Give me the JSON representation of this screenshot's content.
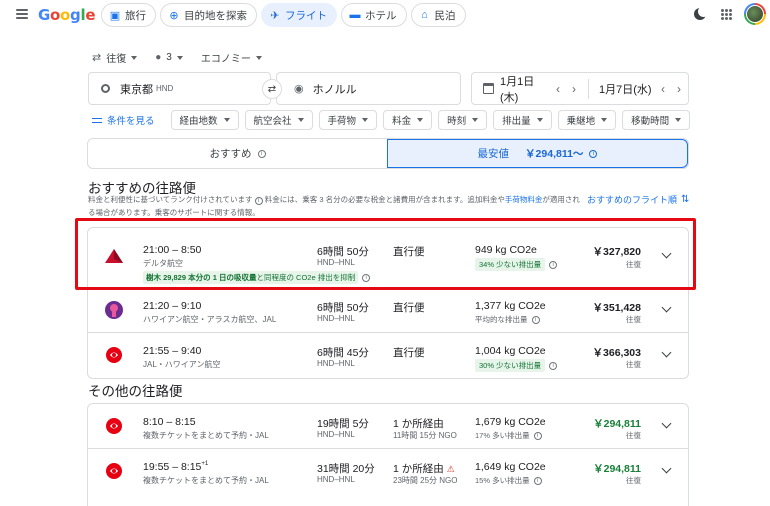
{
  "logo": {
    "g1": "G",
    "o1": "o",
    "o2": "o",
    "g2": "g",
    "l": "l",
    "e": "e"
  },
  "nav": [
    {
      "icon": "suitcase-icon",
      "glyph": "▣",
      "label": "旅行"
    },
    {
      "icon": "explore-icon",
      "glyph": "⊕",
      "label": "目的地を探索"
    },
    {
      "icon": "plane-icon",
      "glyph": "✈",
      "label": "フライト"
    },
    {
      "icon": "hotel-icon",
      "glyph": "▬",
      "label": "ホテル"
    },
    {
      "icon": "house-icon",
      "glyph": "⌂",
      "label": "民泊"
    }
  ],
  "trip": {
    "type": "往復",
    "passengers": "3",
    "cabin": "エコノミー"
  },
  "search": {
    "from": "東京都",
    "from_code": "HND",
    "to": "ホノルル",
    "depart": "1月1日(木)",
    "return": "1月7日(水)"
  },
  "filters": {
    "all": "条件を見る",
    "chips": [
      "経由地数",
      "航空会社",
      "手荷物",
      "料金",
      "時刻",
      "排出量",
      "乗継地",
      "移動時間"
    ]
  },
  "sort": {
    "best": "おすすめ",
    "cheapest": "最安値",
    "cheapest_price": "￥294,811～"
  },
  "best_section": {
    "title": "おすすめの往路便",
    "disclaimer_1": "料金と利便性に基づいてランク付けされています",
    "disclaimer_2": "料金には、乗客 3 名分の必要な税金と諸費用が含まれます。追加料金や",
    "disclaimer_link": "手荷物料金",
    "disclaimer_3": "が適用され",
    "disclaimer_4": "る場合があります。乗客のサポートに関する情報。",
    "sort_link": "おすすめのフライト順"
  },
  "best_flights": [
    {
      "logo": "delta",
      "times": "21:00 – 8:50",
      "sup": "",
      "airline": "デルタ航空",
      "duration": "6時間 50分",
      "route": "HND–HNL",
      "stops": "直行便",
      "stops_sub": "",
      "co2": "949 kg CO2e",
      "co2_badge": "34% 少ない排出量",
      "co2_plain": "",
      "price": "￥327,820",
      "price_sub": "往復",
      "eco_bold": "樹木 29,829 本分の 1 日の吸収量",
      "eco_rest": "と同程度の CO2e 排出を抑制"
    },
    {
      "logo": "hawaiian",
      "times": "21:20 – 9:10",
      "sup": "",
      "airline": "ハワイアン航空・アラスカ航空、JAL",
      "duration": "6時間 50分",
      "route": "HND–HNL",
      "stops": "直行便",
      "stops_sub": "",
      "co2": "1,377 kg CO2e",
      "co2_badge": "",
      "co2_plain": "平均的な排出量",
      "price": "￥351,428",
      "price_sub": "往復"
    },
    {
      "logo": "jal",
      "times": "21:55 – 9:40",
      "sup": "",
      "airline": "JAL・ハワイアン航空",
      "duration": "6時間 45分",
      "route": "HND–HNL",
      "stops": "直行便",
      "stops_sub": "",
      "co2": "1,004 kg CO2e",
      "co2_badge": "30% 少ない排出量",
      "co2_plain": "",
      "price": "￥366,303",
      "price_sub": "往復"
    }
  ],
  "other_section": {
    "title": "その他の往路便"
  },
  "other_flights": [
    {
      "logo": "jal",
      "times": "8:10 – 8:15",
      "sup": "",
      "airline": "複数チケットをまとめて予約・JAL",
      "duration": "19時間 5分",
      "route": "HND–HNL",
      "stops": "1 か所経由",
      "stops_sub": "11時間 15分 NGO",
      "co2": "1,679 kg CO2e",
      "co2_badge": "",
      "co2_plain": "17% 多い排出量",
      "price": "￥294,811",
      "price_sub": "往復"
    },
    {
      "logo": "jal",
      "times": "19:55 – 8:15",
      "sup": "+1",
      "airline": "複数チケットをまとめて予約・JAL",
      "duration": "31時間 20分",
      "route": "HND–HNL",
      "stops": "1 か所経由",
      "stops_sub": "23時間 25分 NGO",
      "co2": "1,649 kg CO2e",
      "co2_badge": "",
      "co2_plain": "15% 多い排出量",
      "price": "￥294,811",
      "price_sub": "往復"
    }
  ]
}
